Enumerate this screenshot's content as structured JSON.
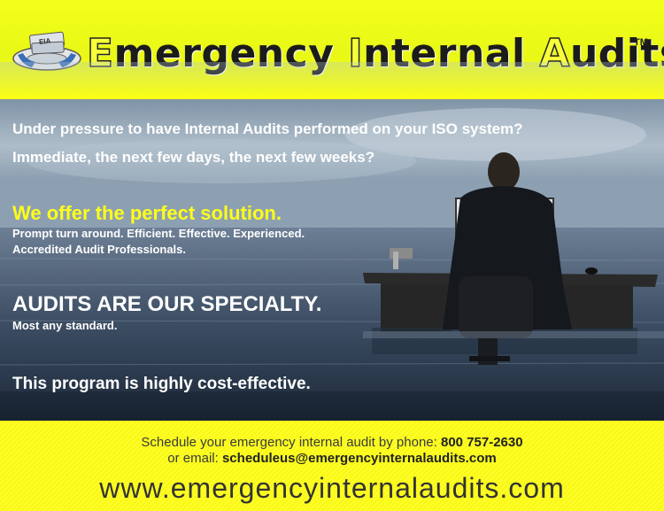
{
  "header": {
    "logo_text": "EIA",
    "title_parts": [
      {
        "text": "E",
        "accent": true
      },
      {
        "text": "mergency ",
        "accent": false
      },
      {
        "text": "I",
        "accent": true
      },
      {
        "text": "nternal ",
        "accent": false
      },
      {
        "text": "A",
        "accent": true
      },
      {
        "text": "udits",
        "accent": false
      }
    ],
    "trademark": "TM"
  },
  "hero": {
    "question_1": "Under pressure to have Internal Audits performed on your ISO system?",
    "question_2": "Immediate, the next few days, the next few weeks?",
    "solution_heading": "We offer the perfect solution.",
    "solution_line_1": "Prompt turn around.  Efficient.  Effective.  Experienced.",
    "solution_line_2": "Accredited Audit Professionals.",
    "specialty_heading": "AUDITS ARE OUR SPECIALTY.",
    "specialty_sub": "Most any standard.",
    "cost_line": "This program is highly cost-effective."
  },
  "footer": {
    "phone_prefix": "Schedule your emergency internal audit by phone: ",
    "phone": "800 757-2630",
    "email_prefix": "or email: ",
    "email": "scheduleus@emergencyinternalaudits.com",
    "website": "www.emergencyinternalaudits.com"
  },
  "colors": {
    "brand_yellow": "#ffff1a",
    "title_dark": "#1b1b1b",
    "hero_text": "#ffffff",
    "accent_text": "#ffff1a"
  },
  "icons": {
    "logo": "life-preserver-with-binders-icon"
  }
}
